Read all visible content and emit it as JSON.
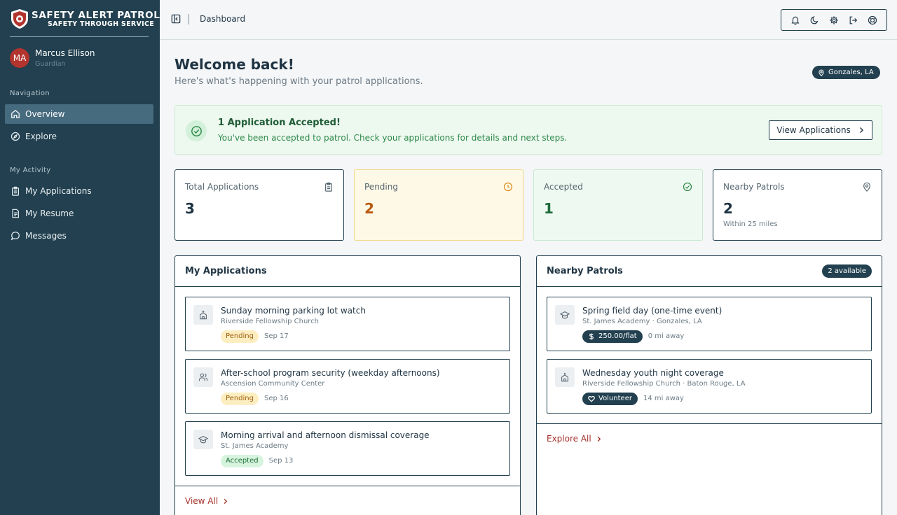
{
  "brand": {
    "title": "SAFETY ALERT PATROL",
    "tagline": "SAFETY THROUGH SERVICE"
  },
  "user": {
    "initials": "MA",
    "name": "Marcus Ellison",
    "role": "Guardian"
  },
  "nav": {
    "heading": "Navigation",
    "items": [
      {
        "label": "Overview",
        "icon": "home-icon"
      },
      {
        "label": "Explore",
        "icon": "compass-icon"
      }
    ],
    "activity_heading": "My Activity",
    "activity_items": [
      {
        "label": "My Applications",
        "icon": "clipboard-icon"
      },
      {
        "label": "My Resume",
        "icon": "document-icon"
      },
      {
        "label": "Messages",
        "icon": "chat-icon"
      }
    ]
  },
  "header": {
    "breadcrumb": "Dashboard"
  },
  "welcome": {
    "title": "Welcome back!",
    "subtitle": "Here's what's happening with your patrol applications.",
    "location": "Gonzales, LA"
  },
  "alert": {
    "title": "1 Application Accepted!",
    "message": "You've been accepted to patrol. Check your applications for details and next steps.",
    "button": "View Applications"
  },
  "stats": [
    {
      "label": "Total Applications",
      "value": "3",
      "note": ""
    },
    {
      "label": "Pending",
      "value": "2",
      "note": ""
    },
    {
      "label": "Accepted",
      "value": "1",
      "note": ""
    },
    {
      "label": "Nearby Patrols",
      "value": "2",
      "note": "Within 25 miles"
    }
  ],
  "applications": {
    "title": "My Applications",
    "items": [
      {
        "title": "Sunday morning parking lot watch",
        "org": "Riverside Fellowship Church",
        "status": "Pending",
        "date": "Sep 17"
      },
      {
        "title": "After-school program security (weekday afternoons)",
        "org": "Ascension Community Center",
        "status": "Pending",
        "date": "Sep 16"
      },
      {
        "title": "Morning arrival and afternoon dismissal coverage",
        "org": "St. James Academy",
        "status": "Accepted",
        "date": "Sep 13"
      }
    ],
    "footer_link": "View All"
  },
  "nearby": {
    "title": "Nearby Patrols",
    "count": "2 available",
    "items": [
      {
        "title": "Spring field day (one-time event)",
        "org": "St. James Academy · Gonzales, LA",
        "pay": "250.00/flat",
        "distance": "0 mi away"
      },
      {
        "title": "Wednesday youth night coverage",
        "org": "Riverside Fellowship Church · Baton Rouge, LA",
        "pay": "Volunteer",
        "distance": "14 mi away"
      }
    ],
    "footer_link": "Explore All"
  },
  "colors": {
    "sidebar": "#22404f",
    "accent_red": "#a5322b",
    "success": "#2e8a4a",
    "pending": "#b85a10"
  }
}
